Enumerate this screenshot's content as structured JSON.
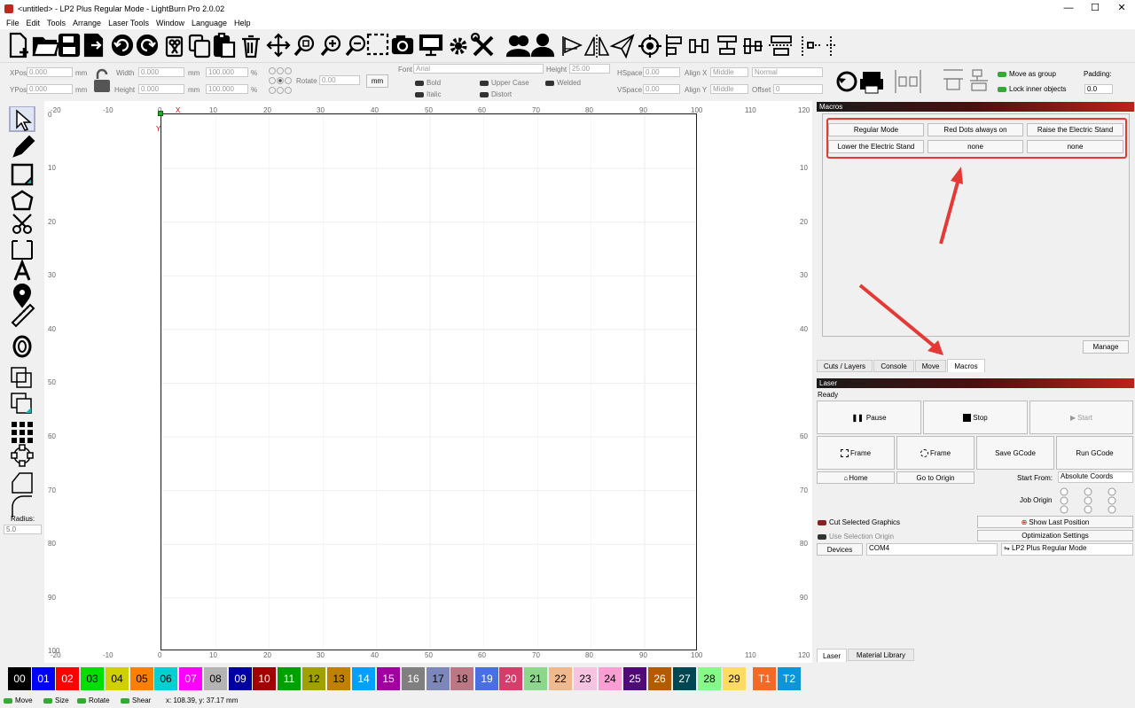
{
  "window": {
    "title": "<untitled> - LP2 Plus Regular Mode - LightBurn Pro 2.0.02",
    "min": "—",
    "max": "☐",
    "close": "✕"
  },
  "menu": [
    "File",
    "Edit",
    "Tools",
    "Arrange",
    "Laser Tools",
    "Window",
    "Language",
    "Help"
  ],
  "toolbar1_icons": [
    "new-file-icon",
    "open-folder-icon",
    "save-icon",
    "export-icon",
    "undo-icon",
    "redo-icon",
    "cut-icon",
    "copy-icon",
    "paste-icon",
    "delete-icon",
    "move-icon",
    "zoom-selection-icon",
    "zoom-in-icon",
    "zoom-out-icon",
    "frame-select-icon",
    "camera-icon",
    "monitor-icon",
    "settings-icon",
    "tools-icon",
    "group-icon",
    "user-icon",
    "mirror-horizontal-icon",
    "mirror-vertical-icon",
    "send-icon",
    "target-icon",
    "align-icon-1",
    "align-icon-2",
    "align-icon-3",
    "align-icon-4",
    "align-icon-5",
    "align-icon-6"
  ],
  "props": {
    "xpos_label": "XPos",
    "xpos": "0.000",
    "ypos_label": "YPos",
    "ypos": "0.000",
    "unit": "mm",
    "width_label": "Width",
    "width": "0.000",
    "height_label": "Height",
    "height": "0.000",
    "wpct": "100.000",
    "hpct": "100.000",
    "pct": "%",
    "rotate_label": "Rotate",
    "rotate": "0.00",
    "mm_btn": "mm",
    "font_label": "Font",
    "font": "Arial",
    "fheight_label": "Height",
    "fheight": "25.00",
    "bold": "Bold",
    "italic": "Italic",
    "upper": "Upper Case",
    "distort": "Distort",
    "welded": "Welded",
    "hspace_label": "HSpace",
    "hspace": "0.00",
    "vspace_label": "VSpace",
    "vspace": "0.00",
    "alignx_label": "Align X",
    "alignx": "Middle",
    "aligny_label": "Align Y",
    "aligny": "Middle",
    "normal": "Normal",
    "offset_label": "Offset",
    "offset": "0",
    "move_group": "Move as group",
    "lock_inner": "Lock inner objects",
    "padding_label": "Padding:",
    "padding": "0.0"
  },
  "left_tools": [
    "select-icon",
    "pencil-icon",
    "rectangle-icon",
    "polygon-icon",
    "scissors-icon",
    "crop-icon",
    "text-icon",
    "position-pin-icon",
    "ruler-icon",
    "offset-icon",
    "boolean-union-icon",
    "boolean-subtract-icon",
    "grid-array-icon",
    "circular-array-icon",
    "corner-icon",
    "rounded-corner-icon"
  ],
  "radius_label": "Radius:",
  "radius": "5.0",
  "ruler": {
    "top": [
      "-20",
      "-10",
      "0",
      "10",
      "20",
      "30",
      "40",
      "50",
      "60",
      "70",
      "80",
      "90",
      "100",
      "110",
      "120"
    ],
    "left": [
      "0",
      "10",
      "20",
      "30",
      "40",
      "50",
      "60",
      "70",
      "80",
      "90",
      "100"
    ],
    "axis_x": "X",
    "axis_y": "Y"
  },
  "macros": {
    "title": "Macros",
    "buttons": [
      "Regular Mode",
      "Red Dots always on",
      "Raise the Electric Stand",
      "Lower the Electric Stand",
      "none",
      "none"
    ],
    "manage": "Manage",
    "tabs": [
      "Cuts / Layers",
      "Console",
      "Move",
      "Macros"
    ]
  },
  "laser": {
    "title": "Laser",
    "status": "Ready",
    "pause": "Pause",
    "stop": "Stop",
    "start": "Start",
    "frame1": "Frame",
    "frame2": "Frame",
    "save_gcode": "Save GCode",
    "run_gcode": "Run GCode",
    "home": "Home",
    "go_origin": "Go to Origin",
    "start_from_label": "Start From:",
    "start_from": "Absolute Coords",
    "job_origin": "Job Origin",
    "cut_selected": "Cut Selected Graphics",
    "use_sel_origin": "Use Selection Origin",
    "show_last": "Show Last Position",
    "opt_settings": "Optimization Settings",
    "devices": "Devices",
    "port": "COM4",
    "device": "LP2 Plus Regular Mode",
    "tabs": [
      "Laser",
      "Material Library"
    ]
  },
  "swatches": [
    {
      "l": "00",
      "c": "#000000",
      "t": "#ffffff"
    },
    {
      "l": "01",
      "c": "#0000ff",
      "t": "#ffffff"
    },
    {
      "l": "02",
      "c": "#ff0000",
      "t": "#ffffff"
    },
    {
      "l": "03",
      "c": "#00e000",
      "t": "#000000"
    },
    {
      "l": "04",
      "c": "#d0d000",
      "t": "#000000"
    },
    {
      "l": "05",
      "c": "#ff8000",
      "t": "#000000"
    },
    {
      "l": "06",
      "c": "#00d0d0",
      "t": "#000000"
    },
    {
      "l": "07",
      "c": "#ff00ff",
      "t": "#ffffff"
    },
    {
      "l": "08",
      "c": "#b4b4b4",
      "t": "#000000"
    },
    {
      "l": "09",
      "c": "#0000a0",
      "t": "#ffffff"
    },
    {
      "l": "10",
      "c": "#a00000",
      "t": "#ffffff"
    },
    {
      "l": "11",
      "c": "#00a000",
      "t": "#ffffff"
    },
    {
      "l": "12",
      "c": "#a0a000",
      "t": "#000000"
    },
    {
      "l": "13",
      "c": "#c08000",
      "t": "#000000"
    },
    {
      "l": "14",
      "c": "#00a0ff",
      "t": "#ffffff"
    },
    {
      "l": "15",
      "c": "#a000a0",
      "t": "#ffffff"
    },
    {
      "l": "16",
      "c": "#808080",
      "t": "#ffffff"
    },
    {
      "l": "17",
      "c": "#7d87b9",
      "t": "#000000"
    },
    {
      "l": "18",
      "c": "#bb7784",
      "t": "#000000"
    },
    {
      "l": "19",
      "c": "#4a6fe3",
      "t": "#ffffff"
    },
    {
      "l": "20",
      "c": "#d33f6a",
      "t": "#ffffff"
    },
    {
      "l": "21",
      "c": "#8cd78c",
      "t": "#000000"
    },
    {
      "l": "22",
      "c": "#f0b98d",
      "t": "#000000"
    },
    {
      "l": "23",
      "c": "#f6c4e1",
      "t": "#000000"
    },
    {
      "l": "24",
      "c": "#fa9ed4",
      "t": "#000000"
    },
    {
      "l": "25",
      "c": "#500a78",
      "t": "#ffffff"
    },
    {
      "l": "26",
      "c": "#b45a00",
      "t": "#ffffff"
    },
    {
      "l": "27",
      "c": "#004754",
      "t": "#ffffff"
    },
    {
      "l": "28",
      "c": "#86fa88",
      "t": "#000000"
    },
    {
      "l": "29",
      "c": "#ffdb66",
      "t": "#000000"
    },
    {
      "l": "T1",
      "c": "#f36926",
      "t": "#ffffff"
    },
    {
      "l": "T2",
      "c": "#0c96d9",
      "t": "#ffffff"
    }
  ],
  "status": {
    "move": "Move",
    "size": "Size",
    "rotate": "Rotate",
    "shear": "Shear",
    "coords": "x: 108.39, y: 37.17 mm"
  },
  "accent": "#e53935"
}
